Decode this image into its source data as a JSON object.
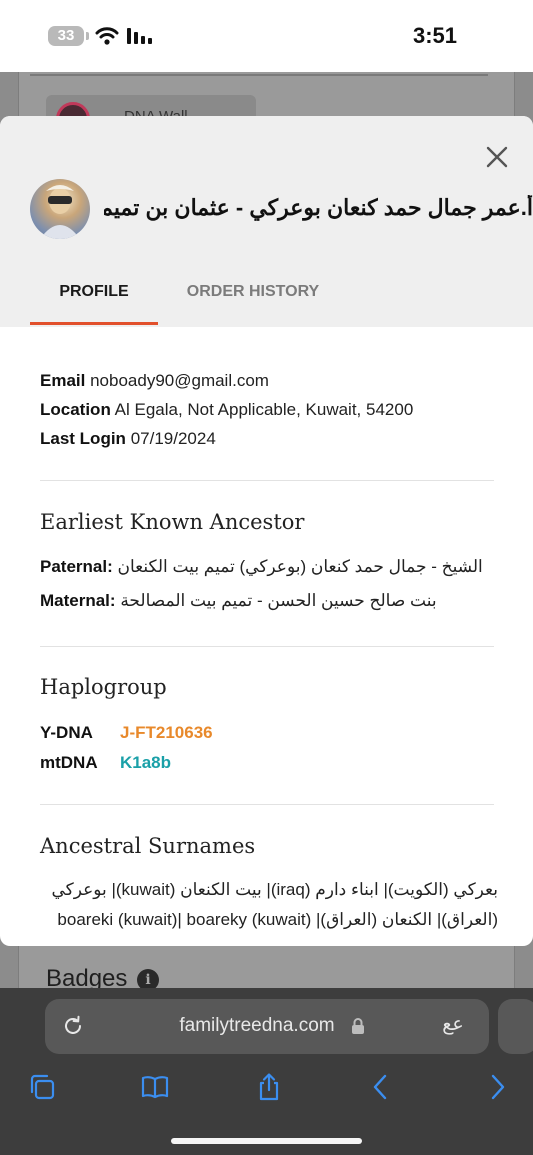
{
  "status_bar": {
    "battery": "33",
    "time": "3:51"
  },
  "background": {
    "chip_label": "DNA Wall",
    "badges_title": "Badges",
    "info_glyph": "i"
  },
  "modal": {
    "close_glyph": "×",
    "user_name": "أ.عمر جمال حمد كنعان بوعركي - عثمان بن تميم",
    "tabs": [
      {
        "label": "PROFILE",
        "active": true
      },
      {
        "label": "ORDER HISTORY",
        "active": false
      }
    ],
    "accent_color": "#e2502c",
    "profile": {
      "email_label": "Email",
      "email": "noboady90@gmail.com",
      "location_label": "Location",
      "location": "Al Egala, Not Applicable, Kuwait, 54200",
      "last_login_label": "Last Login",
      "last_login": "07/19/2024"
    },
    "ancestor": {
      "title": "Earliest Known Ancestor",
      "paternal_label": "Paternal:",
      "paternal": "الشيخ - جمال حمد كنعان (بوعركي) تميم بيت الكنعان",
      "maternal_label": "Maternal:",
      "maternal": "بنت صالح حسين الحسن - تميم بيت المصالحة"
    },
    "haplogroup": {
      "title": "Haplogroup",
      "ydna_label": "Y-DNA",
      "ydna": "J-FT210636",
      "ydna_color": "#e8892b",
      "mtdna_label": "mtDNA",
      "mtdna": "K1a8b",
      "mtdna_color": "#1aa0a8"
    },
    "surnames": {
      "title": "Ancestral Surnames",
      "text": "بعركي (الكويت)| ابناء دارم (iraq)| بيت الكنعان (kuwait)| بوعركي (العراق)| الكنعان (العراق)| boareki (kuwait)| boareky (kuwait)"
    }
  },
  "browser": {
    "url": "familytreedna.com",
    "reader_glyph": "عع",
    "icons": [
      "reload-icon",
      "lock-icon",
      "tabs-icon",
      "bookmarks-icon",
      "share-icon",
      "back-icon",
      "forward-icon"
    ]
  }
}
